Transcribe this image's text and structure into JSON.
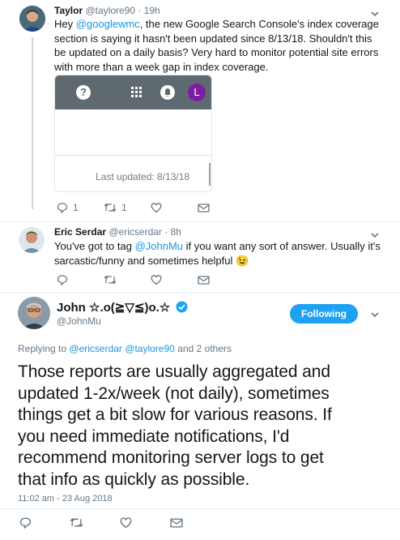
{
  "tweet1": {
    "name": "Taylor",
    "handle": "@taylore90",
    "time": "19h",
    "text_before": "Hey ",
    "mention": "@googlewmc",
    "text_after": ", the new Google Search Console's index coverage section is saying it hasn't been updated since 8/13/18. Shouldn't this be updated on a daily basis? Very hard to monitor potential site errors with more than a week gap in index coverage.",
    "media": {
      "help_glyph": "?",
      "avatar_letter": "L",
      "last_updated": "Last updated: 8/13/18"
    },
    "reply_count": "1",
    "retweet_count": "1"
  },
  "tweet2": {
    "name": "Eric Serdar",
    "handle": "@ericserdar",
    "time": "8h",
    "text_before": "You've got to tag ",
    "mention": "@JohnMu",
    "text_after": " if you want any sort of answer. Usually it's sarcastic/funny and sometimes helpful",
    "emoji": "😉"
  },
  "main_tweet": {
    "name": "John ☆.o(≧▽≦)o.☆",
    "handle": "@JohnMu",
    "follow_label": "Following",
    "replying_prefix": "Replying to",
    "replying_mention1": "@ericserdar",
    "replying_mention2": "@taylore90",
    "replying_suffix": "and 2 others",
    "text_lines": [
      "Those reports are usually aggregated and",
      "updated 1-2x/week (not daily), sometimes",
      "things get a bit slow for various reasons. If",
      "you need immediate notifications, I'd",
      "recommend monitoring server logs to get",
      "that info as quickly as possible."
    ],
    "timestamp": "11:02 am - 23 Aug 2018"
  },
  "colors": {
    "link": "#1b95e0",
    "follow_button": "#1da1f2",
    "muted": "#657786",
    "verified": "#1da1f2",
    "console_bar": "#5f6a70",
    "account_avatar": "#7b1fa2"
  },
  "icons": [
    "chevron-down-icon",
    "reply-icon",
    "retweet-icon",
    "like-icon",
    "message-icon",
    "help-icon",
    "apps-grid-icon",
    "bell-icon",
    "verified-icon"
  ]
}
